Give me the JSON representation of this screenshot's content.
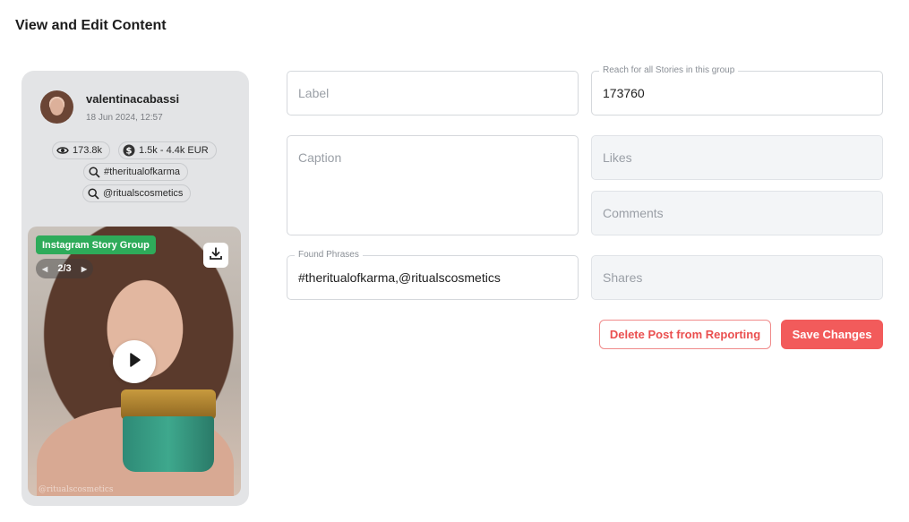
{
  "page": {
    "title": "View and Edit Content"
  },
  "post": {
    "username": "valentinacabassi",
    "date": "18 Jun 2024, 12:57",
    "views": "173.8k",
    "value_range": "1.5k - 4.4k EUR",
    "matches": [
      "#theritualofkarma",
      "@ritualscosmetics"
    ],
    "media": {
      "badge": "Instagram Story Group",
      "pager": "2/3",
      "watermark": "@ritualscosmetics"
    }
  },
  "form": {
    "label": {
      "placeholder": "Label",
      "value": ""
    },
    "reach": {
      "legend": "Reach for all Stories in this group",
      "value": "173760"
    },
    "caption": {
      "placeholder": "Caption",
      "value": ""
    },
    "likes": {
      "placeholder": "Likes",
      "value": ""
    },
    "comments": {
      "placeholder": "Comments",
      "value": ""
    },
    "found_phrases": {
      "legend": "Found Phrases",
      "value": "#theritualofkarma,@ritualscosmetics"
    },
    "shares": {
      "placeholder": "Shares",
      "value": ""
    }
  },
  "actions": {
    "delete_label": "Delete Post from Reporting",
    "save_label": "Save Changes"
  },
  "colors": {
    "accent": "#f25b5b",
    "badge_green": "#2eab5a",
    "card_bg": "#e3e4e6"
  },
  "icons": [
    "eye-icon",
    "dollar-icon",
    "search-icon",
    "download-icon",
    "play-icon",
    "chevron-left-icon",
    "chevron-right-icon"
  ]
}
